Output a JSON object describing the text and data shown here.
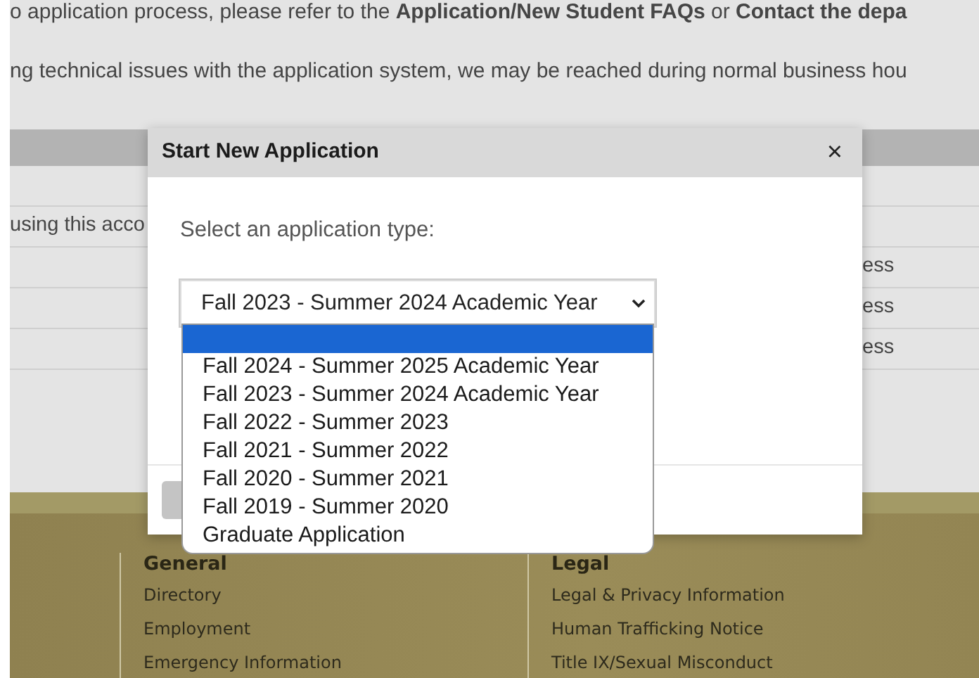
{
  "page": {
    "notice_line": "o application process, please refer to the **Application/New Student FAQs** or **Contact the depa**",
    "support_line": "ng technical issues with the application system, we may be reached during normal business hou",
    "table_rows": [
      {
        "column_1": "",
        "column_2": ""
      },
      {
        "column_1": "using this acco",
        "column_2": ""
      },
      {
        "column_1": "",
        "column_2": "ess"
      },
      {
        "column_1": "",
        "column_2": "ess"
      },
      {
        "column_1": "",
        "column_2": "ess"
      }
    ]
  },
  "footer": {
    "columns": [
      {
        "heading": "General",
        "links": [
          "Directory",
          "Employment",
          "Emergency Information"
        ]
      },
      {
        "heading": "Legal",
        "links": [
          "Legal & Privacy Information",
          "Human Trafficking Notice",
          "Title IX/Sexual Misconduct"
        ]
      }
    ]
  },
  "modal": {
    "title": "Start New Application",
    "close": "×",
    "prompt": "Select an application type:",
    "select": {
      "value": "Fall 2023 - Summer 2024 Academic Year",
      "expanded": true
    },
    "options": [
      {
        "selected": true
      },
      {
        "label": "Fall 2024 - Summer 2025 Academic Year",
        "selected": false
      },
      {
        "label": "Fall 2023 - Summer 2024 Academic Year",
        "selected": false
      },
      {
        "label": "Fall 2022 - Summer 2023",
        "selected": false
      },
      {
        "label": "Fall 2021 - Summer 2022",
        "selected": false
      },
      {
        "label": "Fall 2020 - Summer 2021",
        "selected": false
      },
      {
        "label": "Fall 2019 - Summer 2020",
        "selected": false
      },
      {
        "label": "Graduate Application",
        "selected": false
      }
    ]
  }
}
